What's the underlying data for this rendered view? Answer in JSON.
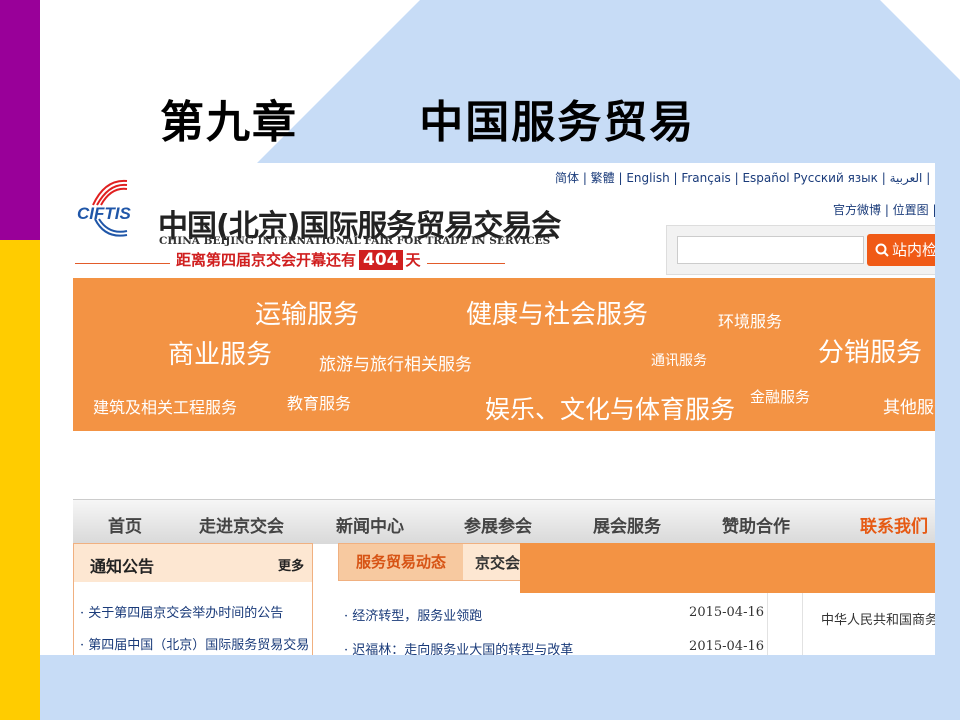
{
  "slide": {
    "title": "第九章       中国服务贸易"
  },
  "site": {
    "logo_abbr": "CIFTIS",
    "name_cn": "中国(北京)国际服务贸易交易会",
    "name_en": "CHINA BEIJING INTERNATIONAL FAIR FOR TRADE IN SERVICES",
    "countdown_prefix": "距离第四届京交会开幕还有",
    "countdown_days": "404",
    "countdown_suffix": "天",
    "languages": "简体 | 繁體 | English | Français | Español Русский язык | العربية | 日本語 |",
    "sub_links": "官方微博 | 位置图 | ",
    "search_button": "站内检"
  },
  "categories": [
    {
      "label": "运输服务"
    },
    {
      "label": "健康与社会服务"
    },
    {
      "label": "环境服务"
    },
    {
      "label": "商业服务"
    },
    {
      "label": "旅游与旅行相关服务"
    },
    {
      "label": "通讯服务"
    },
    {
      "label": "分销服务"
    },
    {
      "label": "建筑及相关工程服务"
    },
    {
      "label": "教育服务"
    },
    {
      "label": "娱乐、文化与体育服务"
    },
    {
      "label": "金融服务"
    },
    {
      "label": "其他服务"
    }
  ],
  "nav": [
    {
      "label": "首页"
    },
    {
      "label": "走进京交会"
    },
    {
      "label": "新闻中心"
    },
    {
      "label": "参展参会"
    },
    {
      "label": "展会服务"
    },
    {
      "label": "赞助合作"
    },
    {
      "label": "联系我们"
    }
  ],
  "notice_panel": {
    "title": "通知公告",
    "more": "更多",
    "items": [
      "· 关于第四届京交会举办时间的公告",
      "· 第四届中国（北京）国际服务贸易交易"
    ]
  },
  "news_panel": {
    "tab_active": "服务贸易动态",
    "tab_other": "京交会",
    "items": [
      {
        "title": "· 经济转型，服务业领跑",
        "date": "2015-04-16"
      },
      {
        "title": "· 迟福林：走向服务业大国的转型与改革",
        "date": "2015-04-16"
      }
    ]
  },
  "right_panel": {
    "text": "中华人民共和国商务"
  },
  "colors": {
    "purple": "#990099",
    "yellow": "#ffcc00",
    "orange": "#f39344",
    "accent": "#e65a14"
  }
}
